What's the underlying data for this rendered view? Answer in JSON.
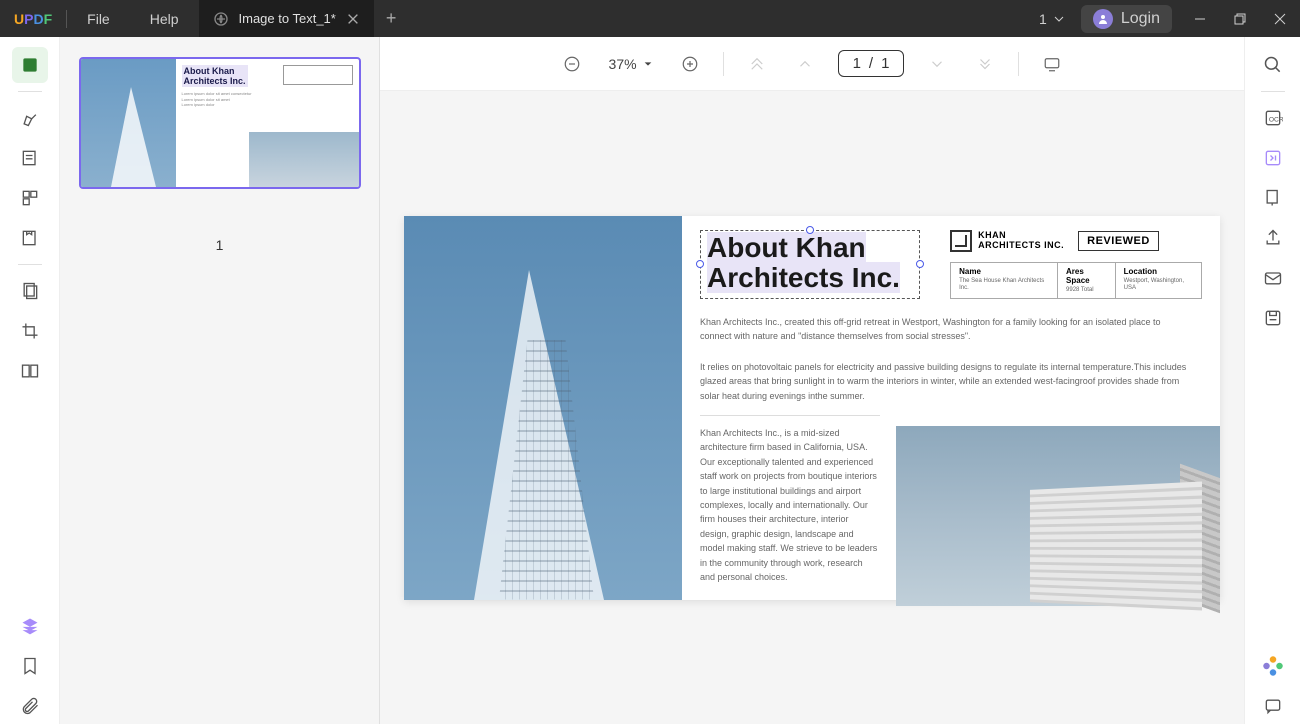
{
  "titlebar": {
    "menu_file": "File",
    "menu_help": "Help",
    "tab_title": "Image to Text_1*",
    "page_indicator": "1",
    "login_label": "Login"
  },
  "toolbar": {
    "zoom": "37%",
    "page_current": "1",
    "page_sep": "/",
    "page_total": "1"
  },
  "thumb": {
    "number": "1"
  },
  "doc": {
    "title_line1": "About Khan",
    "title_line2": "Architects Inc.",
    "company_line1": "KHAN",
    "company_line2": "ARCHITECTS INC.",
    "reviewed": "REVIEWED",
    "table": {
      "h1": "Name",
      "v1": "The Sea House Khan Architects Inc.",
      "h2": "Ares Space",
      "v2": "9928 Total",
      "h3": "Location",
      "v3": "Westport, Washington, USA"
    },
    "para1": "Khan Architects Inc., created this off-grid retreat in Westport, Washington for a family looking for an isolated place to connect with nature and \"distance themselves from social stresses\".",
    "para2": "It relies on photovoltaic panels for electricity and passive building designs to regulate its internal temperature.This includes glazed areas that bring sunlight in to warm the interiors in winter, while an extended west-facingroof provides shade from solar heat during evenings inthe summer.",
    "para3": "Khan Architects Inc., is a mid-sized architecture firm based in California, USA. Our exceptionally talented and experienced staff work on projects from boutique interiors to large institutional buildings and airport complexes, locally and internationally. Our firm houses their architecture, interior design, graphic design, landscape and model making staff. We strieve to be leaders in the community through work, research and personal choices."
  }
}
